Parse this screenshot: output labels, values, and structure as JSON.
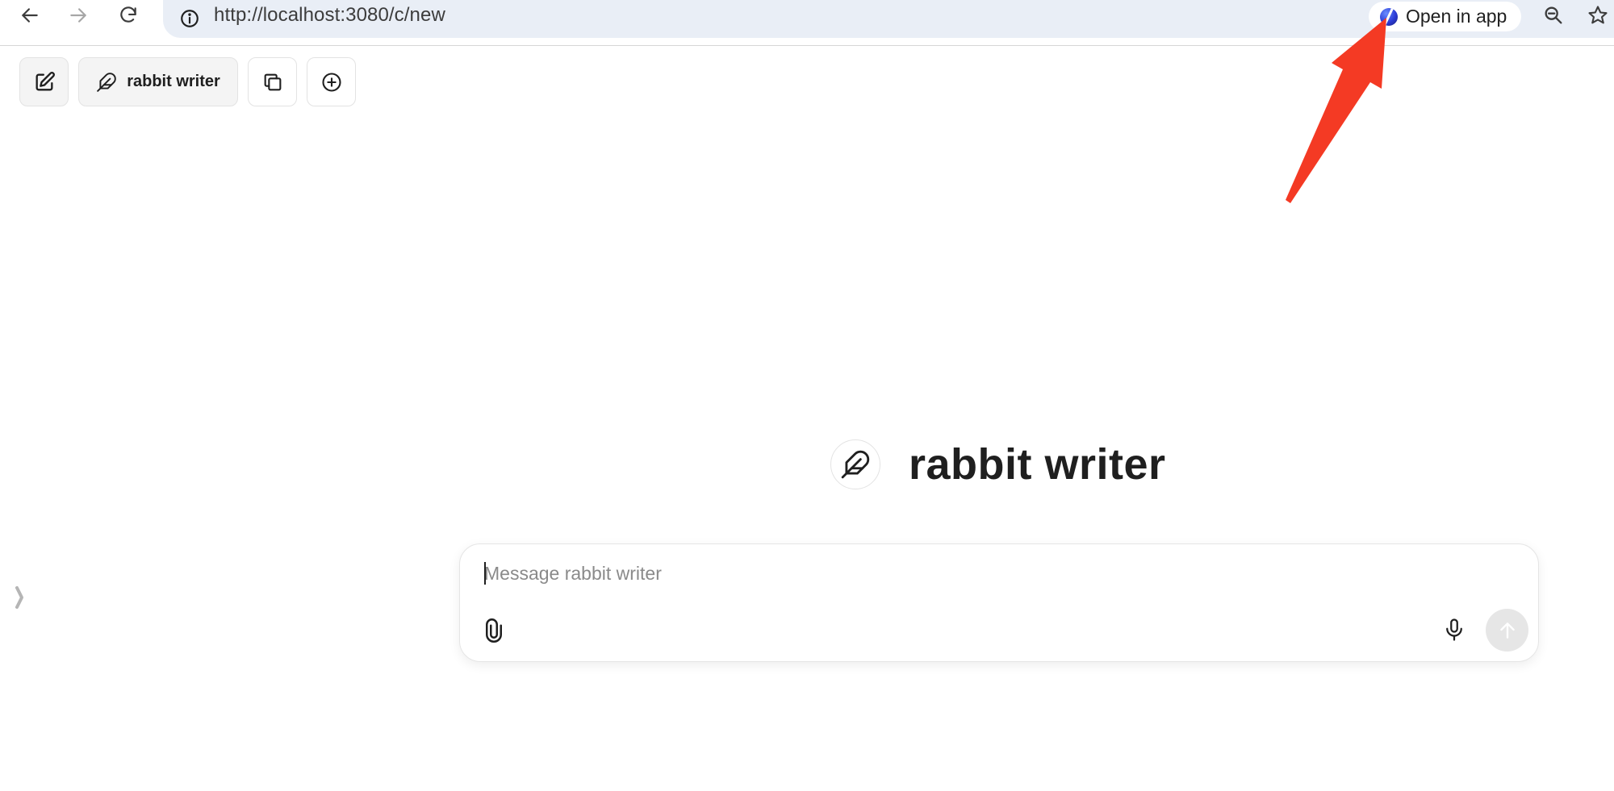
{
  "browser": {
    "url": "http://localhost:3080/c/new",
    "open_in_app_label": "Open in app",
    "icons": {
      "back": "arrow-left-icon",
      "forward": "arrow-right-icon",
      "reload": "reload-icon",
      "site_info": "info-circle-icon",
      "zoom": "zoom-out-magnifier-icon",
      "bookmark": "star-icon",
      "app": "app-logo-icon"
    }
  },
  "toolbar": {
    "agent_label": "rabbit writer",
    "icons": {
      "new_chat": "edit-pencil-icon",
      "agent": "feather-icon",
      "copy": "copy-icon",
      "add": "plus-circle-icon"
    }
  },
  "landing": {
    "title": "rabbit writer",
    "avatar_icon": "feather-icon"
  },
  "composer": {
    "placeholder": "Message rabbit writer",
    "value": "",
    "icons": {
      "attach": "paperclip-icon",
      "mic": "microphone-icon",
      "send": "arrow-up-icon"
    }
  },
  "sidebar": {
    "toggle_icon": "chevron-right-icon"
  },
  "colors": {
    "omnibox_bg": "#e9eef6",
    "annotation_arrow": "#f43a24",
    "send_disabled_bg": "#e6e6e6",
    "text_primary": "#1f1f1f"
  }
}
